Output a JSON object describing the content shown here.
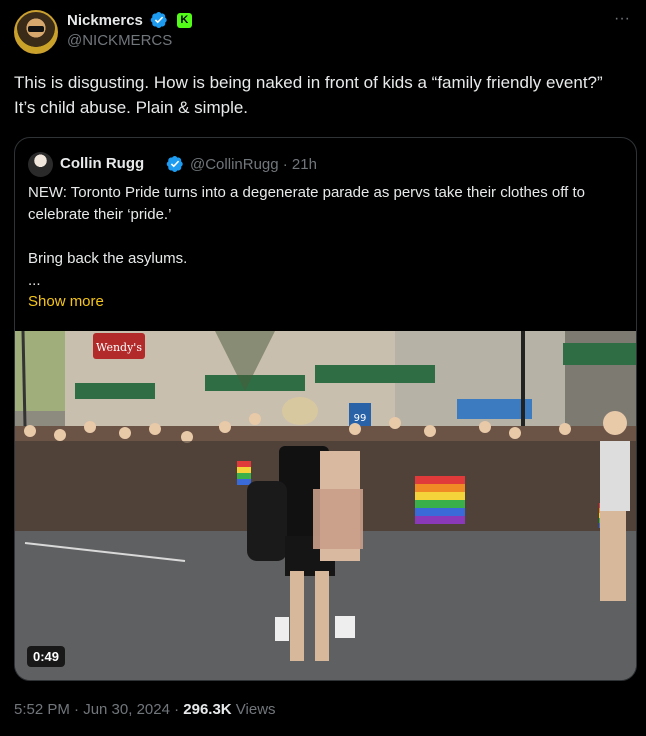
{
  "author": {
    "display_name": "Nickmercs",
    "handle": "@NICKMERCS"
  },
  "tweet": {
    "text": "This is disgusting. How is being naked in front of kids a “family friendly event?” It’s child abuse. Plain & simple."
  },
  "quote": {
    "display_name": "Collin Rugg",
    "handle_time": "@CollinRugg · 21h",
    "line1": "NEW: Toronto Pride turns into a degenerate parade as pervs take their clothes off to celebrate their ‘pride.’",
    "line2": "Bring back the asylums.",
    "line3": "...",
    "show_more": "Show more",
    "video_duration": "0:49",
    "media_sign_1": "Wendy's",
    "media_sign_2": "99"
  },
  "meta": {
    "time_date": "5:52 PM · Jun 30, 2024 · ",
    "views_count": "296.3K",
    "views_label": " Views"
  },
  "colors": {
    "background": "#000000",
    "text": "#e7e9ea",
    "muted": "#71767b",
    "verified": "#1d9bf0",
    "link": "#f5c518",
    "kick": "#53fc18"
  }
}
